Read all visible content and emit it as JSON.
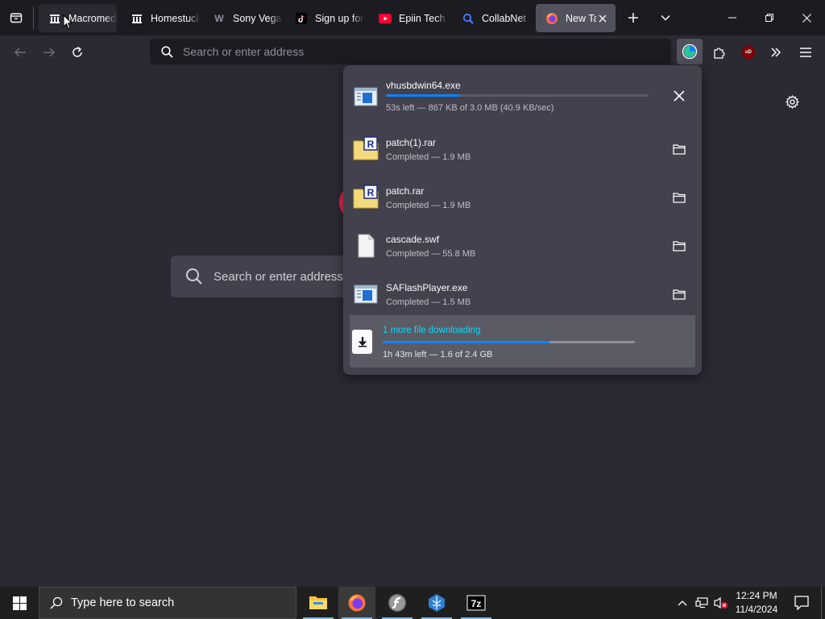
{
  "tabs": [
    {
      "title": "Macromedia",
      "icon": "library-icon",
      "state": "hover"
    },
    {
      "title": "Homestuck",
      "icon": "library-icon",
      "state": "normal"
    },
    {
      "title": "Sony Vegas",
      "icon": "w-logo-icon",
      "state": "normal"
    },
    {
      "title": "Sign up for",
      "icon": "tiktok-icon",
      "state": "normal"
    },
    {
      "title": "Epiin Tech",
      "icon": "youtube-icon",
      "state": "normal"
    },
    {
      "title": "CollabNet",
      "icon": "search-icon",
      "state": "normal"
    },
    {
      "title": "New Tab",
      "icon": "firefox-icon",
      "state": "selected"
    }
  ],
  "toolbar": {
    "url_placeholder": "Search or enter address",
    "ublock_badge": "uD"
  },
  "newtab": {
    "search_placeholder": "Search or enter address"
  },
  "downloads": {
    "items": [
      {
        "name": "vhusbdwin64.exe",
        "status": "53s left — 867 KB of 3.0 MB (40.9 KB/sec)",
        "progress": 0.28,
        "file_icon": "exe-icon",
        "action": "cancel"
      },
      {
        "name": "patch(1).rar",
        "status": "Completed — 1.9 MB",
        "file_icon": "rar-icon",
        "action": "open-folder"
      },
      {
        "name": "patch.rar",
        "status": "Completed — 1.9 MB",
        "file_icon": "rar-icon",
        "action": "open-folder"
      },
      {
        "name": "cascade.swf",
        "status": "Completed — 55.8 MB",
        "file_icon": "blank-file-icon",
        "action": "open-folder"
      },
      {
        "name": "SAFlashPlayer.exe",
        "status": "Completed — 1.5 MB",
        "file_icon": "exe-icon",
        "action": "open-folder"
      }
    ],
    "summary": {
      "title": "1 more file downloading",
      "status": "1h 43m left — 1.6 of 2.4 GB",
      "progress": 0.66
    }
  },
  "taskbar": {
    "search_placeholder": "Type here to search",
    "clock_time": "12:24 PM",
    "clock_date": "11/4/2024"
  },
  "colors": {
    "accent": "#0a84ff",
    "summary_link": "#00ddff",
    "taskbar_underline": "#76b9ed"
  }
}
